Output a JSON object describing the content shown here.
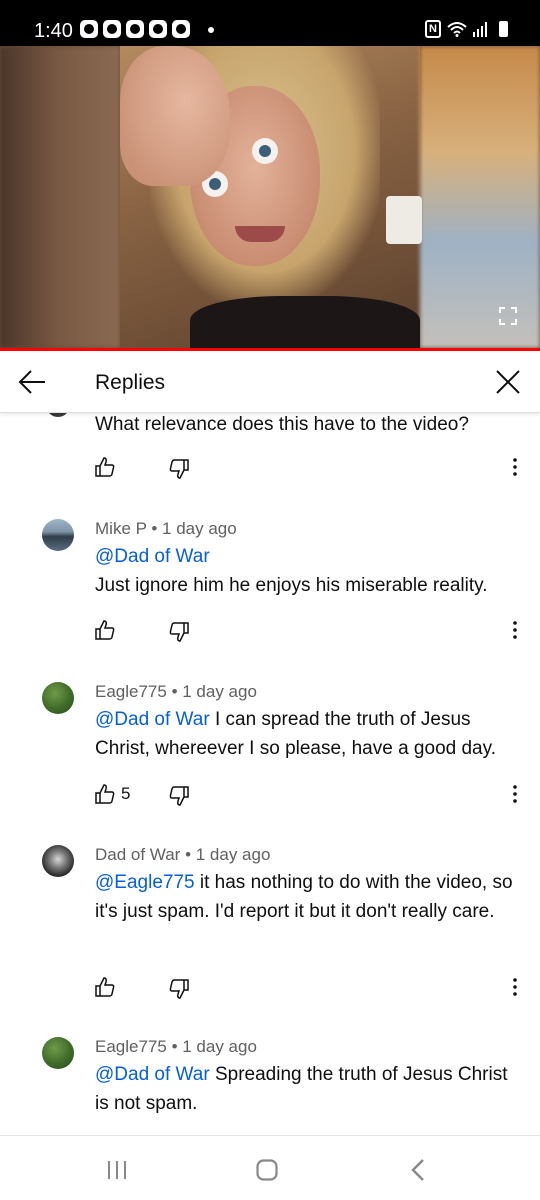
{
  "status_bar": {
    "time": "1:40",
    "notification_icons": [
      "app-icon",
      "app-icon",
      "app-icon",
      "app-icon",
      "app-icon"
    ],
    "right_icons": [
      "nfc-icon",
      "wifi-icon",
      "signal-icon",
      "battery-icon"
    ],
    "nfc_label": "N"
  },
  "video": {
    "progress_color": "#ff0000"
  },
  "header": {
    "title": "Replies"
  },
  "comments": [
    {
      "author": "",
      "time": "",
      "text": "What relevance does this have to the video?",
      "likes": ""
    },
    {
      "author": "Mike P",
      "meta": "Mike P • 1 day ago",
      "mention": "@Dad of War",
      "text": "Just ignore him he enjoys his miserable reality.",
      "likes": ""
    },
    {
      "author": "Eagle775",
      "meta": "Eagle775 • 1 day ago",
      "mention": "@Dad of War",
      "text": "I can spread the truth of Jesus Christ, whereever I so please, have a good day.",
      "likes": "5"
    },
    {
      "author": "Dad of War",
      "meta": "Dad of War • 1 day ago",
      "mention": "@Eagle775",
      "text": "it has nothing to do with the video, so it's just spam. I'd report it but it don't really care.",
      "likes": ""
    },
    {
      "author": "Eagle775",
      "meta": "Eagle775 • 1 day ago",
      "mention": "@Dad of War",
      "text": "Spreading the truth of Jesus Christ is not spam.",
      "likes": ""
    }
  ],
  "colors": {
    "mention": "#065fd4",
    "meta": "#606060",
    "text": "#0f0f0f"
  }
}
